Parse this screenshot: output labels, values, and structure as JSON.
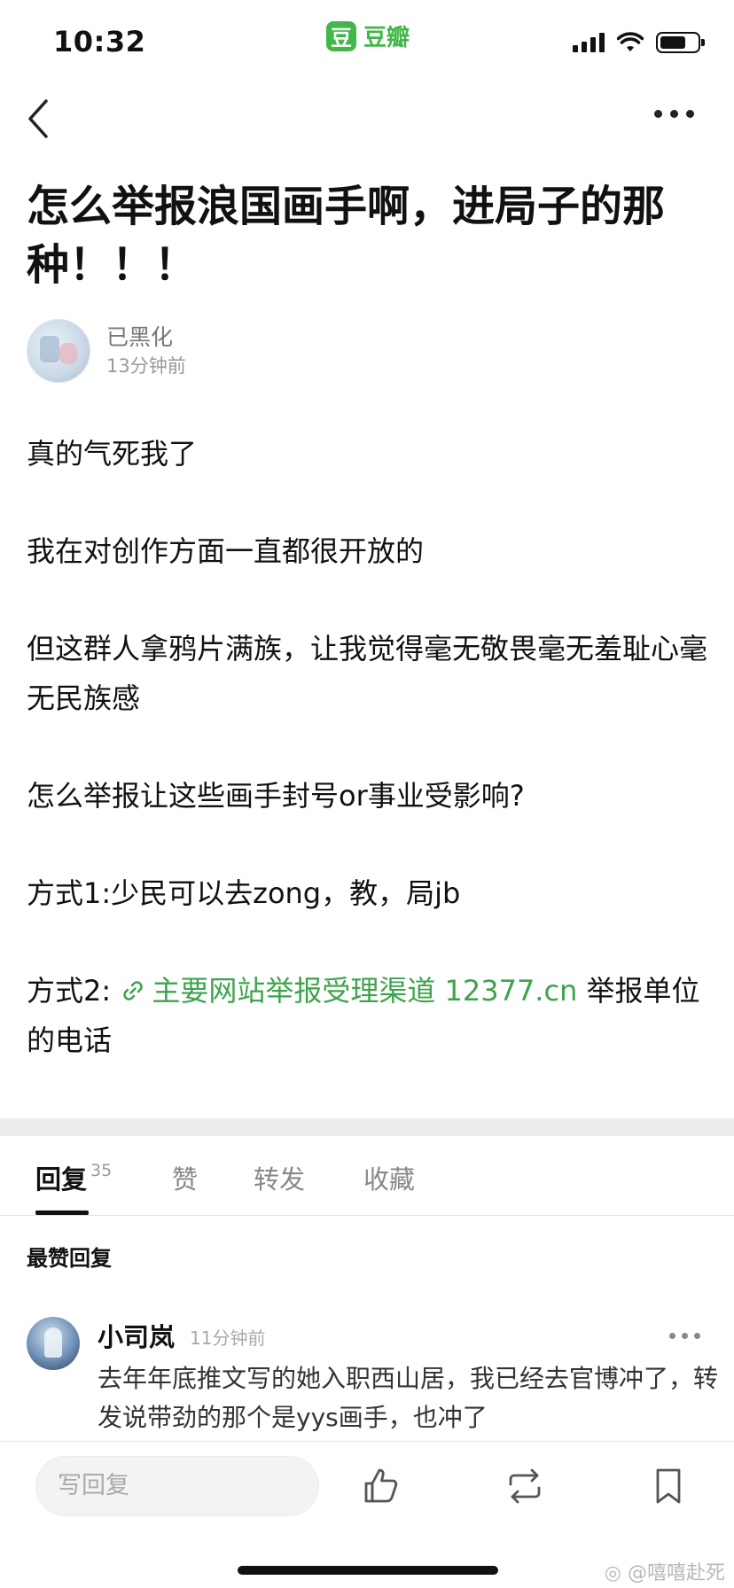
{
  "status_bar": {
    "time": "10:32",
    "app_badge_logo": "豆",
    "app_badge_name": "豆瓣"
  },
  "post": {
    "title": "怎么举报浪国画手啊，进局子的那种！！！",
    "author_name": "已黑化",
    "author_time": "13分钟前",
    "paragraphs": {
      "p1": "真的气死我了",
      "p2": "我在对创作方面一直都很开放的",
      "p3": "但这群人拿鸦片满族，让我觉得毫无敬畏毫无羞耻心毫无民族感",
      "p4": "怎么举报让这些画手封号or事业受影响?",
      "p5": "方式1:少民可以去zong，教，局jb",
      "p6_prefix": "方式2: ",
      "p6_link": "主要网站举报受理渠道 12377.cn",
      "p6_suffix": " 举报单位的电话"
    }
  },
  "tabs": [
    {
      "label": "回复",
      "count": "35"
    },
    {
      "label": "赞"
    },
    {
      "label": "转发"
    },
    {
      "label": "收藏"
    }
  ],
  "section_heading": "最赞回复",
  "comment": {
    "author": "小司岚",
    "time": "11分钟前",
    "text": "去年年底推文写的她入职西山居，我已经去官博冲了，转发说带劲的那个是yys画手，也冲了"
  },
  "bottom_bar": {
    "reply_placeholder": "写回复"
  },
  "watermark": "@嘻嘻赴死",
  "colors": {
    "accent_green": "#43b649",
    "link_green": "#3fa34d"
  },
  "icons": [
    "back-arrow-icon",
    "more-dots-icon",
    "link-icon",
    "thumbs-up-icon",
    "repost-icon",
    "bookmark-icon",
    "weibo-icon"
  ]
}
